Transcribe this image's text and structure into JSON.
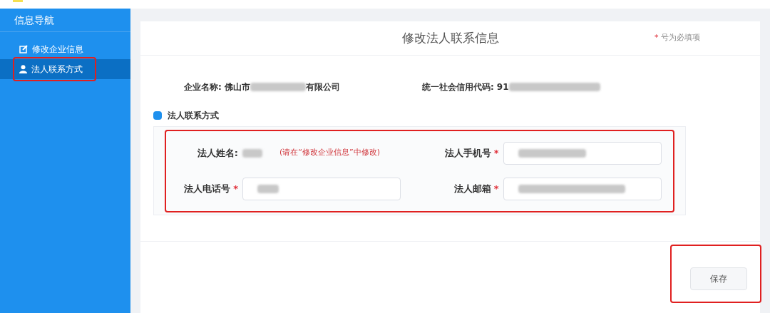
{
  "sidebar": {
    "title": "信息导航",
    "items": [
      {
        "label": "修改企业信息",
        "kind": "edit",
        "selected": false
      },
      {
        "label": "法人联系方式",
        "kind": "user",
        "selected": true
      }
    ]
  },
  "page": {
    "title": "修改法人联系信息",
    "required_note_mark": "*",
    "required_note": "号为必填项"
  },
  "company": {
    "name_label": "企业名称:",
    "name_prefix": "佛山市",
    "name_suffix": "有限公司",
    "code_label": "统一社会信用代码:",
    "code_prefix": "91"
  },
  "section": {
    "title": "法人联系方式"
  },
  "form": {
    "fields": [
      {
        "kind": "static",
        "label": "法人姓名:",
        "required": false,
        "hint": "(请在“修改企业信息”中修改)"
      },
      {
        "kind": "input",
        "label": "法人手机号",
        "required": true
      },
      {
        "kind": "input",
        "label": "法人电话号",
        "required": true
      },
      {
        "kind": "input",
        "label": "法人邮箱",
        "required": true
      }
    ]
  },
  "save_button": "保存"
}
